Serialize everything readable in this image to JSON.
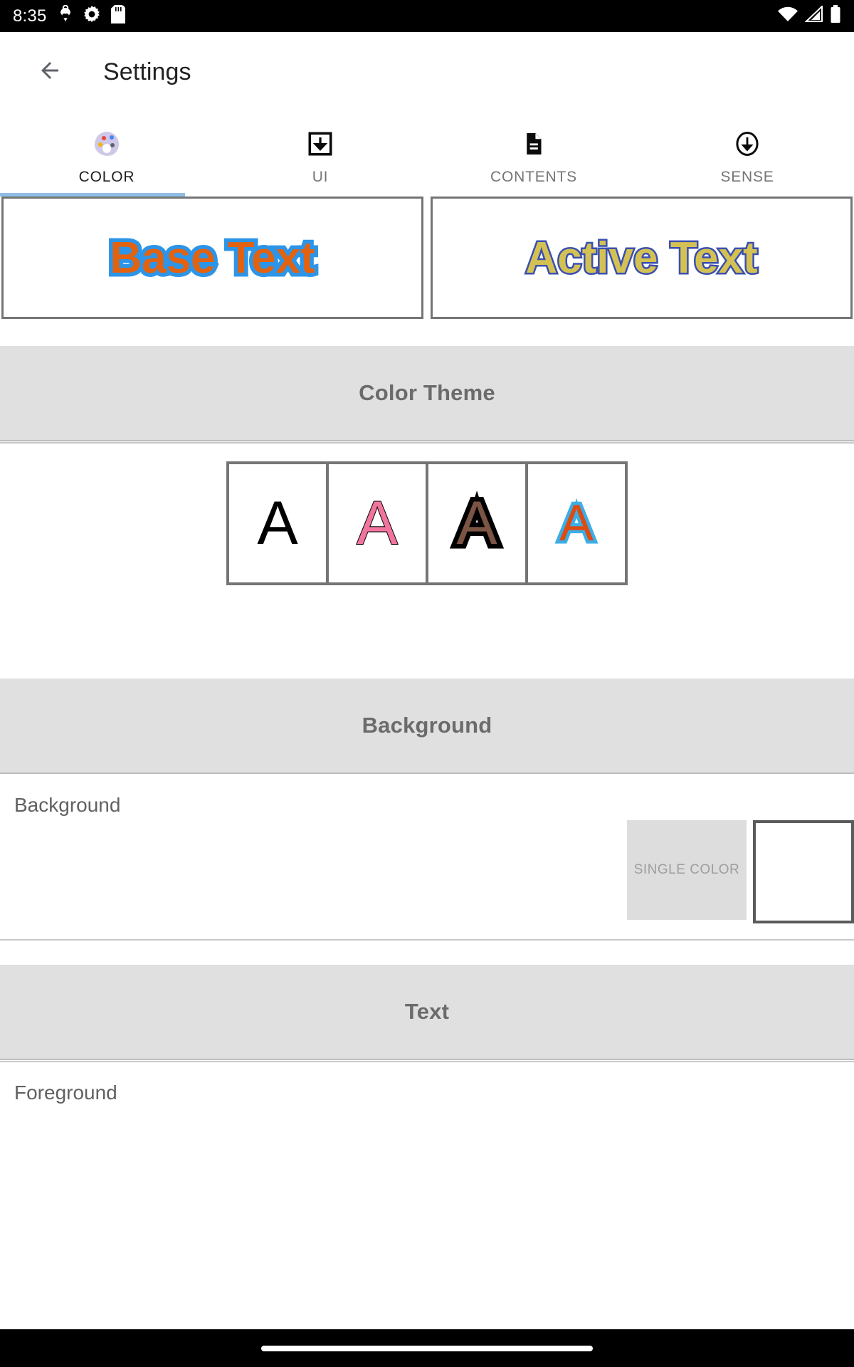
{
  "status_bar": {
    "time": "8:35",
    "left_icons": [
      "heart-pulse-icon",
      "gear-icon",
      "sd-card-icon"
    ],
    "right_icons": [
      "wifi-icon",
      "cellular-signal-icon",
      "battery-icon"
    ]
  },
  "app_bar": {
    "back_icon": "arrow-back-icon",
    "title": "Settings"
  },
  "tabs": {
    "active_index": 0,
    "items": [
      {
        "label": "COLOR",
        "icon": "palette-icon"
      },
      {
        "label": "UI",
        "icon": "download-box-icon"
      },
      {
        "label": "CONTENTS",
        "icon": "document-icon"
      },
      {
        "label": "SENSE",
        "icon": "circle-arrow-down-icon"
      }
    ],
    "indicator_color": "#90BDE3"
  },
  "preview": {
    "base": {
      "text": "Base Text",
      "fill_color": "#E2620F",
      "outline_color": "#2D95E8"
    },
    "active": {
      "text": "Active Text",
      "fill_color": "#D4C154",
      "outline_color": "#3A4FB0"
    }
  },
  "sections": {
    "color_theme": {
      "title": "Color Theme",
      "swatch_letter": "A",
      "swatches": [
        {
          "name": "theme-black",
          "fill": "#000000",
          "stroke": "none",
          "stroke_width": "0px"
        },
        {
          "name": "theme-pink",
          "fill": "#F0749C",
          "stroke": "#000000",
          "stroke_width": "2px"
        },
        {
          "name": "theme-brown-black",
          "fill": "#7B5443",
          "stroke": "#000000",
          "stroke_width": "13px"
        },
        {
          "name": "theme-orange-blue",
          "fill": "#DD4B11",
          "stroke": "#3BAEE8",
          "stroke_width": "9px"
        }
      ]
    },
    "background": {
      "title": "Background",
      "row_label": "Background",
      "single_color_label": "SINGLE COLOR",
      "chip_color": "#FFFFFF"
    },
    "text": {
      "title": "Text",
      "row_label": "Foreground"
    }
  },
  "nav_bar": {
    "handle": "home-gesture-pill"
  }
}
